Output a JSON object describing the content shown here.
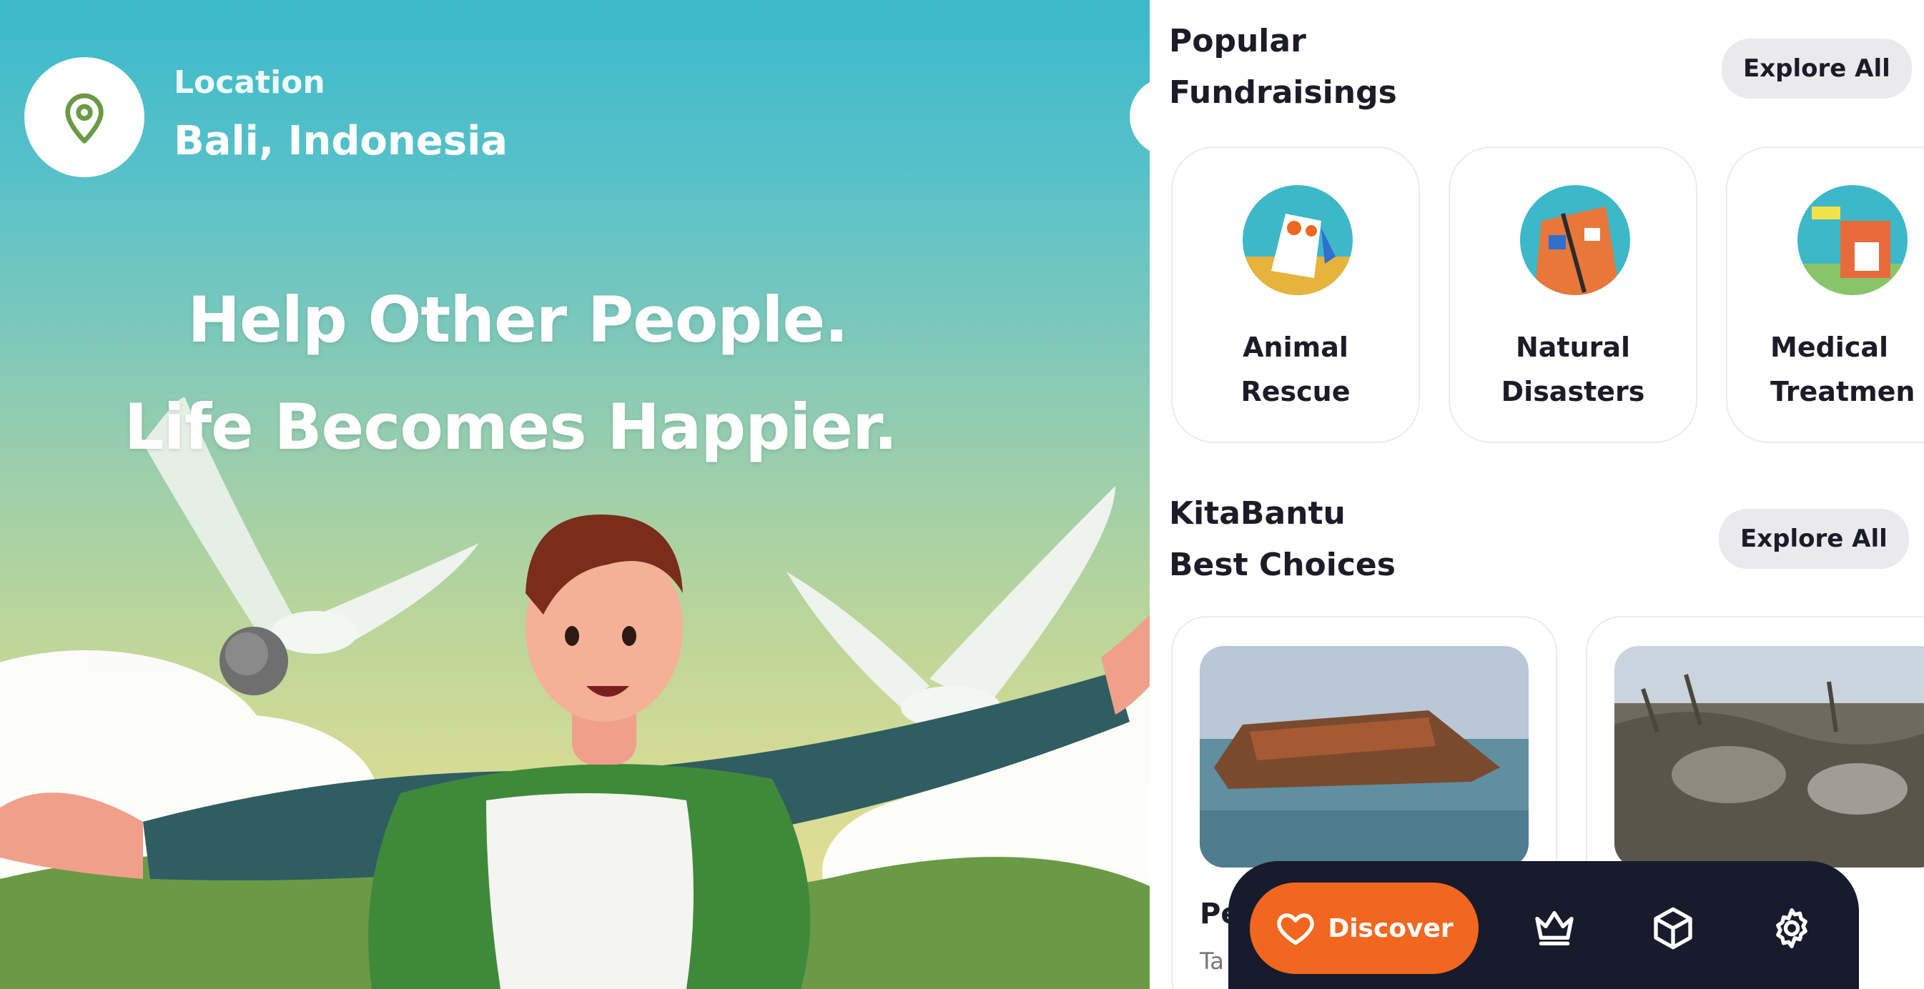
{
  "hero": {
    "location_label": "Location",
    "location_value": "Bali, Indonesia",
    "headline_line1": "Help Other People.",
    "headline_line2": "Life Becomes Happier."
  },
  "popular": {
    "title_line1": "Popular",
    "title_line2": "Fundraisings",
    "explore_label": "Explore All",
    "categories": [
      {
        "line1": "Animal",
        "line2": "Rescue",
        "icon": "animal-rescue-icon"
      },
      {
        "line1": "Natural",
        "line2": "Disasters",
        "icon": "natural-disasters-icon"
      },
      {
        "line1": "Medical",
        "line2": "Treatmen",
        "icon": "medical-treatment-icon"
      }
    ]
  },
  "best": {
    "title_line1": "KitaBantu",
    "title_line2": "Best Choices",
    "explore_label": "Explore All",
    "cards": [
      {
        "title": "Pe",
        "subtitle": "Ta"
      },
      {
        "title": "",
        "subtitle": ""
      }
    ]
  },
  "nav": {
    "discover_label": "Discover",
    "items": [
      "heart-icon",
      "crown-icon",
      "box-icon",
      "gear-icon"
    ]
  },
  "colors": {
    "accent": "#f1671f",
    "nav_bg": "#171b2c",
    "text_dark": "#1c1c28",
    "pill_bg": "#e9e9ee"
  }
}
